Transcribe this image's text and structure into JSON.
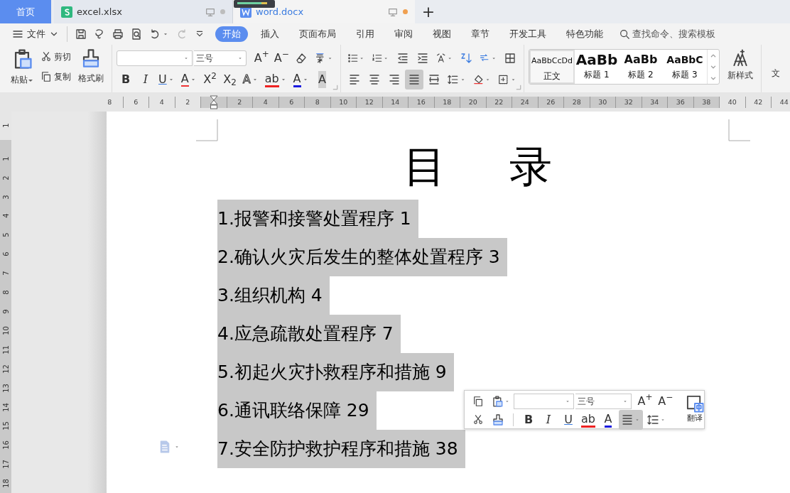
{
  "tabs": [
    {
      "kind": "home",
      "label": "首页",
      "selected": false
    },
    {
      "kind": "sheet",
      "label": "excel.xlsx",
      "selected": false,
      "modified": false
    },
    {
      "kind": "doc",
      "label": "word.docx",
      "selected": true,
      "modified": true
    }
  ],
  "new_tab": "+",
  "menu": {
    "file": "文件",
    "items": [
      {
        "label": "开始",
        "selected": true
      },
      {
        "label": "插入",
        "selected": false
      },
      {
        "label": "页面布局",
        "selected": false
      },
      {
        "label": "引用",
        "selected": false
      },
      {
        "label": "审阅",
        "selected": false
      },
      {
        "label": "视图",
        "selected": false
      },
      {
        "label": "章节",
        "selected": false
      },
      {
        "label": "开发工具",
        "selected": false
      },
      {
        "label": "特色功能",
        "selected": false
      }
    ],
    "search_hint": "查找命令、搜索模板"
  },
  "clipboard": {
    "paste": "粘贴",
    "cut": "剪切",
    "copy": "复制",
    "format_painter": "格式刷"
  },
  "font": {
    "font_size": "三号",
    "grow": "A$^{+}$",
    "shrink": "A$^{−}$",
    "format_buttons": [
      {
        "kind": "bold",
        "label": "B"
      },
      {
        "kind": "italic",
        "label": "I"
      },
      {
        "kind": "underline",
        "label": "U"
      },
      {
        "kind": "strike",
        "label": "A"
      },
      {
        "kind": "sup",
        "label": "X$^{2}$"
      },
      {
        "kind": "sub",
        "label": "X$_{2}$"
      },
      {
        "kind": "outline",
        "label": "A"
      },
      {
        "kind": "highlight",
        "label": "ab"
      },
      {
        "kind": "color",
        "label": "A"
      },
      {
        "kind": "shade",
        "label": "A"
      }
    ]
  },
  "paragraph": {
    "align_buttons": [
      {
        "kind": "left",
        "selected": false
      },
      {
        "kind": "center",
        "selected": false
      },
      {
        "kind": "right",
        "selected": false
      },
      {
        "kind": "justify",
        "selected": true
      },
      {
        "kind": "distributed",
        "selected": false
      }
    ]
  },
  "styles": [
    {
      "preview": "AaBbCcDd",
      "label": "正文",
      "kind": "normal",
      "selected": true
    },
    {
      "preview": "AaBb",
      "label": "标题 1",
      "kind": "h1",
      "selected": false
    },
    {
      "preview": "AaBb",
      "label": "标题 2",
      "kind": "h2",
      "selected": false
    },
    {
      "preview": "AaBbC",
      "label": "标题 3",
      "kind": "h3",
      "selected": false
    }
  ],
  "new_style": "新样式",
  "text_tools": "文",
  "h_ruler": [
    {
      "label": "8",
      "in_text": false
    },
    {
      "label": "6",
      "in_text": false
    },
    {
      "label": "4",
      "in_text": false
    },
    {
      "label": "2",
      "in_text": false
    },
    {
      "kind": "indent",
      "in_text": true
    },
    {
      "label": "2",
      "in_text": true
    },
    {
      "label": "4",
      "in_text": true
    },
    {
      "label": "6",
      "in_text": true
    },
    {
      "label": "8",
      "in_text": true
    },
    {
      "label": "10",
      "in_text": true
    },
    {
      "label": "12",
      "in_text": true
    },
    {
      "label": "14",
      "in_text": true
    },
    {
      "label": "16",
      "in_text": true
    },
    {
      "label": "18",
      "in_text": true
    },
    {
      "label": "20",
      "in_text": true
    },
    {
      "label": "22",
      "in_text": true
    },
    {
      "label": "24",
      "in_text": true
    },
    {
      "label": "26",
      "in_text": true
    },
    {
      "label": "28",
      "in_text": true
    },
    {
      "label": "30",
      "in_text": true
    },
    {
      "label": "32",
      "in_text": true
    },
    {
      "label": "34",
      "in_text": true
    },
    {
      "label": "36",
      "in_text": true
    },
    {
      "label": "38",
      "in_text": true
    },
    {
      "label": "40",
      "in_text": false
    },
    {
      "label": "42",
      "in_text": false
    },
    {
      "label": "44",
      "in_text": false
    }
  ],
  "v_ruler": [
    {
      "label": "1",
      "in_text": false
    },
    {
      "label": "1",
      "in_text": true
    },
    {
      "label": "2",
      "in_text": true
    },
    {
      "label": "3",
      "in_text": true
    },
    {
      "label": "4",
      "in_text": true
    },
    {
      "label": "5",
      "in_text": true
    },
    {
      "label": "6",
      "in_text": true
    },
    {
      "label": "7",
      "in_text": true
    },
    {
      "label": "8",
      "in_text": true
    },
    {
      "label": "9",
      "in_text": true
    },
    {
      "label": "10",
      "in_text": true
    },
    {
      "label": "11",
      "in_text": true
    },
    {
      "label": "12",
      "in_text": true
    },
    {
      "label": "13",
      "in_text": true
    },
    {
      "label": "14",
      "in_text": true
    },
    {
      "label": "15",
      "in_text": true
    },
    {
      "label": "16",
      "in_text": true
    },
    {
      "label": "17",
      "in_text": true
    },
    {
      "label": "18",
      "in_text": true
    }
  ],
  "document": {
    "title": "目 录",
    "toc": [
      {
        "text": "1.报警和接警处置程序 1",
        "selected": true
      },
      {
        "text": "2.确认火灾后发生的整体处置程序 3",
        "selected": true
      },
      {
        "text": "3.组织机构 4",
        "selected": true
      },
      {
        "text": "4.应急疏散处置程序 7",
        "selected": true
      },
      {
        "text": "5.初起火灾扑救程序和措施 9",
        "selected": true
      },
      {
        "text": "6.通讯联络保障 29",
        "selected": true
      },
      {
        "text": "7.安全防护救护程序和措施 38",
        "selected": true
      }
    ]
  },
  "mini_toolbar": {
    "font_size": "三号",
    "grow": "A$^{+}$",
    "shrink": "A$^{−}$",
    "translate": "翻译",
    "format_buttons": [
      {
        "kind": "bold",
        "label": "B"
      },
      {
        "kind": "italic",
        "label": "I"
      },
      {
        "kind": "underline",
        "label": "U"
      },
      {
        "kind": "highlight",
        "label": "ab"
      },
      {
        "kind": "color",
        "label": "A"
      }
    ],
    "align_selected": true
  }
}
